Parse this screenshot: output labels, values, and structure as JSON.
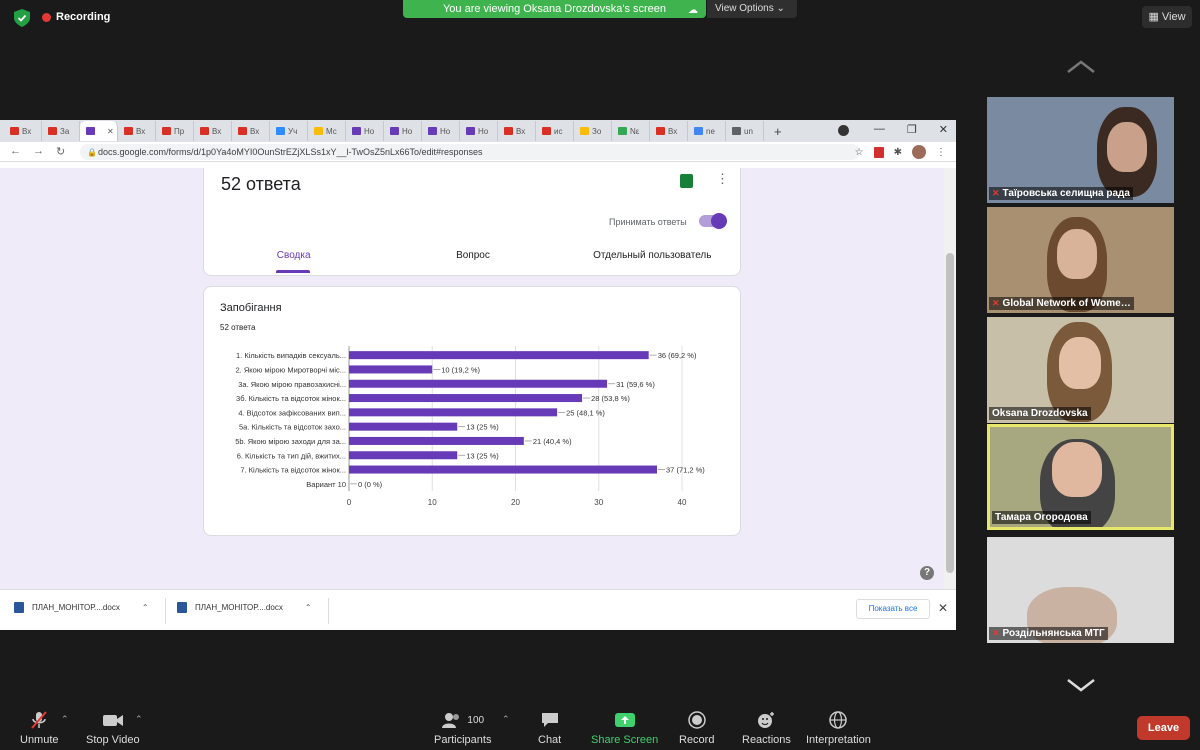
{
  "zoom": {
    "recording_label": "Recording",
    "viewing_banner": "You are viewing Oksana Drozdovska's screen",
    "view_options_label": "View Options",
    "view_button": "View",
    "controls": {
      "unmute": "Unmute",
      "stop_video": "Stop Video",
      "participants": "Participants",
      "participant_count": "100",
      "chat": "Chat",
      "share_screen": "Share Screen",
      "record": "Record",
      "reactions": "Reactions",
      "interpretation": "Interpretation",
      "leave": "Leave"
    },
    "participants": [
      {
        "name": "Таїровська селищна рада",
        "muted": true
      },
      {
        "name": "Global Network of Wome…",
        "muted": true
      },
      {
        "name": "Oksana Drozdovska",
        "muted": false
      },
      {
        "name": "Тамара Огородова",
        "muted": false,
        "active_speaker": true
      },
      {
        "name": "Роздільнянська МТГ",
        "muted": true
      }
    ],
    "accent_green": "#3fb44e",
    "leave_color": "#c0392b"
  },
  "browser": {
    "tabs": [
      "Вх",
      "За",
      "",
      "Вх",
      "Пр",
      "Вх",
      "Вх",
      "Уч",
      "Мс",
      "Но",
      "Но",
      "Но",
      "Но",
      "Вх",
      "ис",
      "Зо",
      "Nε",
      "Вх",
      "ne",
      "un"
    ],
    "url": "docs.google.com/forms/d/1p0Ya4oMYI0OunStrEZjXLSs1xY__l-TwOsZ5nLx66To/edit#responses",
    "downloads": [
      {
        "name": "ПЛАН_МОНІТОР....docx"
      },
      {
        "name": "ПЛАН_МОНІТОР....docx"
      }
    ],
    "show_all": "Показать все"
  },
  "form": {
    "response_count": "52 ответа",
    "accept_responses": "Принимать ответы",
    "tabs": [
      "Сводка",
      "Вопрос",
      "Отдельный пользователь"
    ],
    "active_tab": 0,
    "question_title": "Запобігання",
    "question_count": "52 ответа",
    "accent": "#673ab7"
  },
  "chart_data": {
    "type": "bar",
    "orientation": "horizontal",
    "title": "Запобігання",
    "categories": [
      "1. Кількість випадків сексуаль...",
      "2. Якою мірою Миротворчі міс...",
      "3а. Якою мірою правозахисні...",
      "3б. Кількість та відсоток жінок...",
      "4. Відсоток зафіксованих вип...",
      "5а. Кількість та відсоток захо...",
      "5b. Якою мірою заходи для за...",
      "6. Кількість та тип дій, вжитих...",
      "7. Кількість та відсоток жінок...",
      "Вариант 10"
    ],
    "values": [
      36,
      10,
      31,
      28,
      25,
      13,
      21,
      13,
      37,
      0
    ],
    "data_labels": [
      "36 (69,2 %)",
      "10 (19,2 %)",
      "31 (59,6 %)",
      "28 (53,8 %)",
      "25 (48,1 %)",
      "13 (25 %)",
      "21 (40,4 %)",
      "13 (25 %)",
      "37 (71,2 %)",
      "0 (0 %)"
    ],
    "xlim": [
      0,
      40
    ],
    "xticks": [
      0,
      10,
      20,
      30,
      40
    ],
    "grid": true,
    "bar_color": "#673ab7"
  }
}
